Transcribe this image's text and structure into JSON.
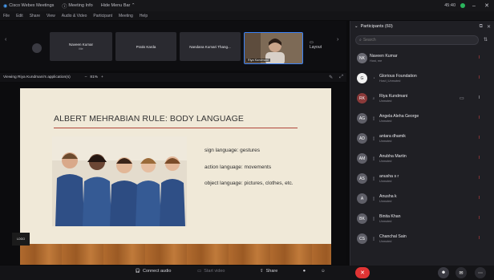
{
  "titlebar": {
    "items": [
      {
        "icon": "webex-logo-icon",
        "label": "Cisco Webex Meetings"
      },
      {
        "icon": "info-icon",
        "label": "Meeting Info"
      },
      {
        "icon": "",
        "label": "Hide Menu Bar ⌃"
      }
    ],
    "time": "45:40",
    "minimize": "–",
    "close": "✕"
  },
  "menubar": [
    "File",
    "Edit",
    "Share",
    "View",
    "Audio & Video",
    "Participant",
    "Meeting",
    "Help"
  ],
  "video_strip": {
    "tiles": [
      {
        "name": "Naveen Kumar",
        "sub": "Me"
      },
      {
        "name": "Pratis Karda",
        "sub": ""
      },
      {
        "name": "Nandana Kumari Thang...",
        "sub": ""
      }
    ],
    "active_tile_name": "Riya Kundmani",
    "layout_label": "Layout"
  },
  "share_bar": {
    "viewing": "Viewing Riya Kundmani's application(s)",
    "zoom_minus": "–",
    "zoom": "81%",
    "zoom_plus": "+"
  },
  "slide": {
    "title": "ALBERT MEHRABIAN RULE: BODY LANGUAGE",
    "bullets": [
      "sign language: gestures",
      "action language: movements",
      "object language: pictures, clothes, etc."
    ],
    "badge": "LOGO"
  },
  "bottombar": {
    "connect_audio": "Connect audio",
    "start_video": "Start video",
    "share": "Share",
    "end": "✕"
  },
  "panel": {
    "title": "Participants (60)",
    "search_placeholder": "Search",
    "participants": [
      {
        "initials": "NK",
        "name": "Naveen Kumar",
        "sub": "Host, me",
        "avatar_color": "#6a6a73"
      },
      {
        "initials": "G",
        "name": "Glorious Foundation",
        "sub": "Host | Unmuted",
        "avatar_color": "#f2f2f2"
      },
      {
        "initials": "RK",
        "name": "Riya Kundmani",
        "sub": "Unmuted",
        "avatar_color": "#8b3a3a"
      },
      {
        "initials": "AG",
        "name": "Angela Aleha George",
        "sub": "Unmuted",
        "avatar_color": "#5f5f68"
      },
      {
        "initials": "AD",
        "name": "antara dhamik",
        "sub": "Unmuted",
        "avatar_color": "#5f5f68"
      },
      {
        "initials": "AM",
        "name": "Anubha Martin",
        "sub": "Unmuted",
        "avatar_color": "#5f5f68"
      },
      {
        "initials": "AS",
        "name": "anusha s r",
        "sub": "Unmuted",
        "avatar_color": "#5f5f68"
      },
      {
        "initials": "A",
        "name": "Anusha k",
        "sub": "Unmuted",
        "avatar_color": "#5f5f68"
      },
      {
        "initials": "BK",
        "name": "Binita Khan",
        "sub": "Unmuted",
        "avatar_color": "#5f5f68"
      },
      {
        "initials": "CS",
        "name": "Chanchal Sain",
        "sub": "Unmuted",
        "avatar_color": "#5f5f68"
      },
      {
        "initials": "",
        "name": "",
        "sub": "",
        "avatar_color": "#5f5f68"
      }
    ]
  },
  "colors": {
    "accent": "#3b82f6",
    "end_call": "#e03434",
    "muted": "#e04848",
    "online": "#2bb55d"
  }
}
